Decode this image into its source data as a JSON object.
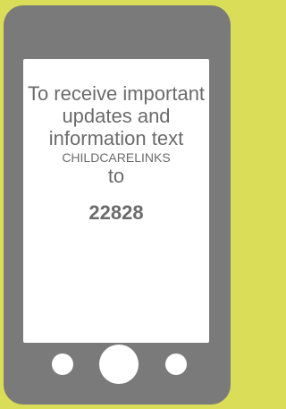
{
  "screen": {
    "message": "To receive important updates and information text",
    "keyword": "CHILDCARELINKS",
    "to": "to",
    "number": "22828"
  },
  "colors": {
    "background": "#d9dd57",
    "phone_body": "#7a7a7a",
    "screen": "#ffffff",
    "text": "#6b6b6b"
  }
}
